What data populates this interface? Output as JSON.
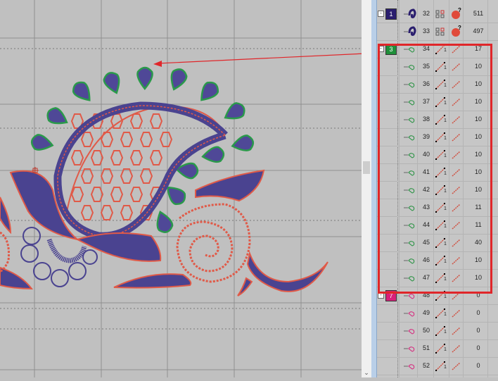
{
  "colors": {
    "navy": "#4a4390",
    "red": "#e05a48",
    "green": "#2a9a4a",
    "highlight": "#e0262a",
    "group1": "#2a1e6e",
    "group3": "#1f8f3a",
    "group7": "#d8207a"
  },
  "rows": [
    {
      "group": "1",
      "num": "32",
      "value": "511",
      "color": "#2a1e6e",
      "type": "satin"
    },
    {
      "group": "",
      "num": "33",
      "value": "497",
      "color": "#2a1e6e",
      "type": "satin"
    },
    {
      "group": "3",
      "num": "34",
      "value": "17",
      "color": "#1f8f3a",
      "type": "run"
    },
    {
      "group": "",
      "num": "35",
      "value": "10",
      "color": "#1f8f3a",
      "type": "run"
    },
    {
      "group": "",
      "num": "36",
      "value": "10",
      "color": "#1f8f3a",
      "type": "run"
    },
    {
      "group": "",
      "num": "37",
      "value": "10",
      "color": "#1f8f3a",
      "type": "run"
    },
    {
      "group": "",
      "num": "38",
      "value": "10",
      "color": "#1f8f3a",
      "type": "run"
    },
    {
      "group": "",
      "num": "39",
      "value": "10",
      "color": "#1f8f3a",
      "type": "run"
    },
    {
      "group": "",
      "num": "40",
      "value": "10",
      "color": "#1f8f3a",
      "type": "run"
    },
    {
      "group": "",
      "num": "41",
      "value": "10",
      "color": "#1f8f3a",
      "type": "run"
    },
    {
      "group": "",
      "num": "42",
      "value": "10",
      "color": "#1f8f3a",
      "type": "run"
    },
    {
      "group": "",
      "num": "43",
      "value": "11",
      "color": "#1f8f3a",
      "type": "run"
    },
    {
      "group": "",
      "num": "44",
      "value": "11",
      "color": "#1f8f3a",
      "type": "run"
    },
    {
      "group": "",
      "num": "45",
      "value": "40",
      "color": "#1f8f3a",
      "type": "run"
    },
    {
      "group": "",
      "num": "46",
      "value": "10",
      "color": "#1f8f3a",
      "type": "run"
    },
    {
      "group": "",
      "num": "47",
      "value": "10",
      "color": "#1f8f3a",
      "type": "run"
    },
    {
      "group": "7",
      "num": "48",
      "value": "0",
      "color": "#d8207a",
      "type": "run"
    },
    {
      "group": "",
      "num": "49",
      "value": "0",
      "color": "#d8207a",
      "type": "run"
    },
    {
      "group": "",
      "num": "50",
      "value": "0",
      "color": "#d8207a",
      "type": "run"
    },
    {
      "group": "",
      "num": "51",
      "value": "0",
      "color": "#d8207a",
      "type": "run"
    },
    {
      "group": "",
      "num": "52",
      "value": "0",
      "color": "#d8207a",
      "type": "run"
    }
  ],
  "run_badge": "1"
}
